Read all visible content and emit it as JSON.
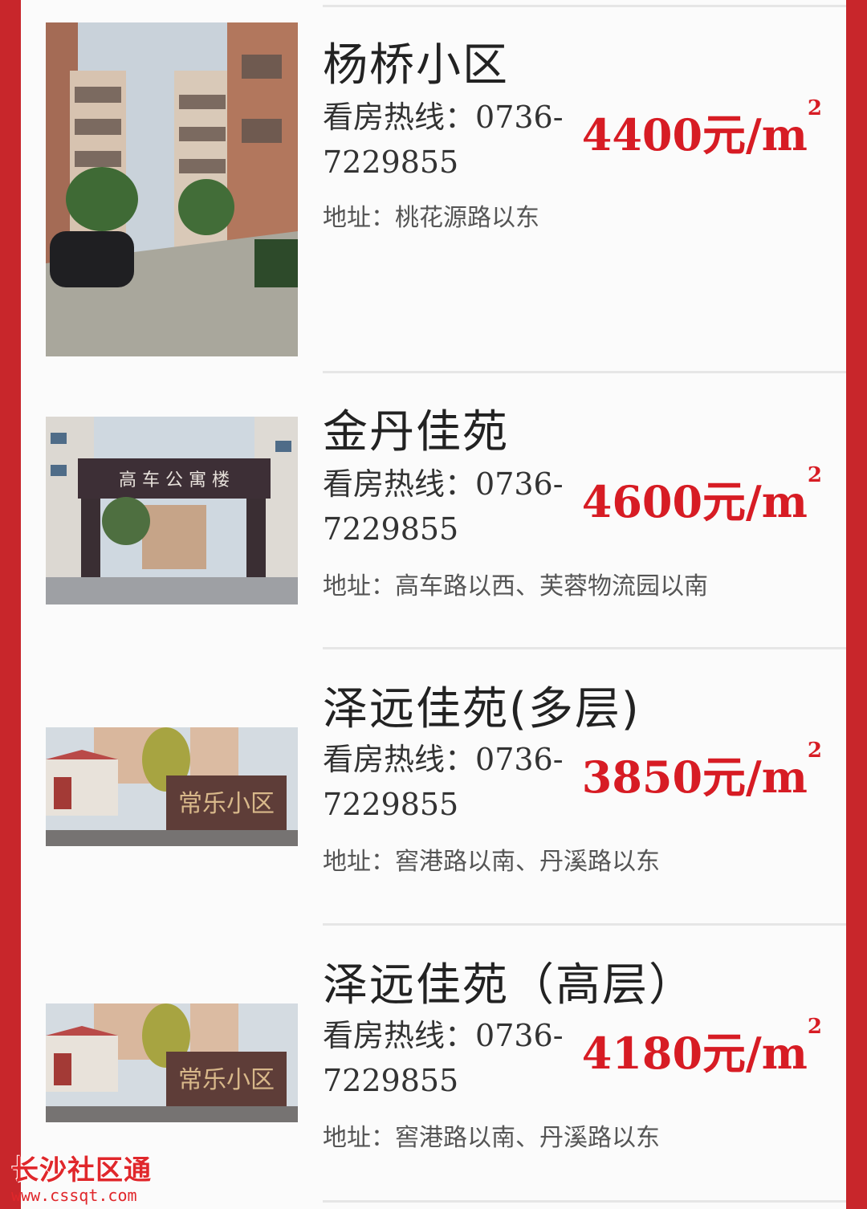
{
  "listings": [
    {
      "name": "杨桥小区",
      "hotline_label": "看房热线：",
      "hotline_number_line1": "0736-",
      "hotline_number_line2": "7229855",
      "price_value": "4400元/m",
      "price_sup": "2",
      "address_label": "地址：",
      "address": "桃花源路以东"
    },
    {
      "name": "金丹佳苑",
      "hotline_label": "看房热线：",
      "hotline_number_line1": "0736-",
      "hotline_number_line2": "7229855",
      "price_value": "4600元/m",
      "price_sup": "2",
      "address_label": "地址：",
      "address": "高车路以西、芙蓉物流园以南"
    },
    {
      "name": "泽远佳苑(多层)",
      "hotline_label": "看房热线：",
      "hotline_number_line1": "0736-",
      "hotline_number_line2": "7229855",
      "price_value": "3850元/m",
      "price_sup": "2",
      "address_label": "地址：",
      "address": "窖港路以南、丹溪路以东"
    },
    {
      "name": "泽远佳苑（高层）",
      "hotline_label": "看房热线：",
      "hotline_number_line1": "0736-",
      "hotline_number_line2": "7229855",
      "price_value": "4180元/m",
      "price_sup": "2",
      "address_label": "地址：",
      "address": "窖港路以南、丹溪路以东"
    }
  ],
  "gate_sign_text": "高 车 公 寓 楼",
  "wall_sign_text": "常乐小区",
  "watermark": {
    "title": "长沙社区通",
    "url": "www.cssqt.com"
  },
  "colors": {
    "frame": "#c8262b",
    "price": "#d71c24"
  }
}
